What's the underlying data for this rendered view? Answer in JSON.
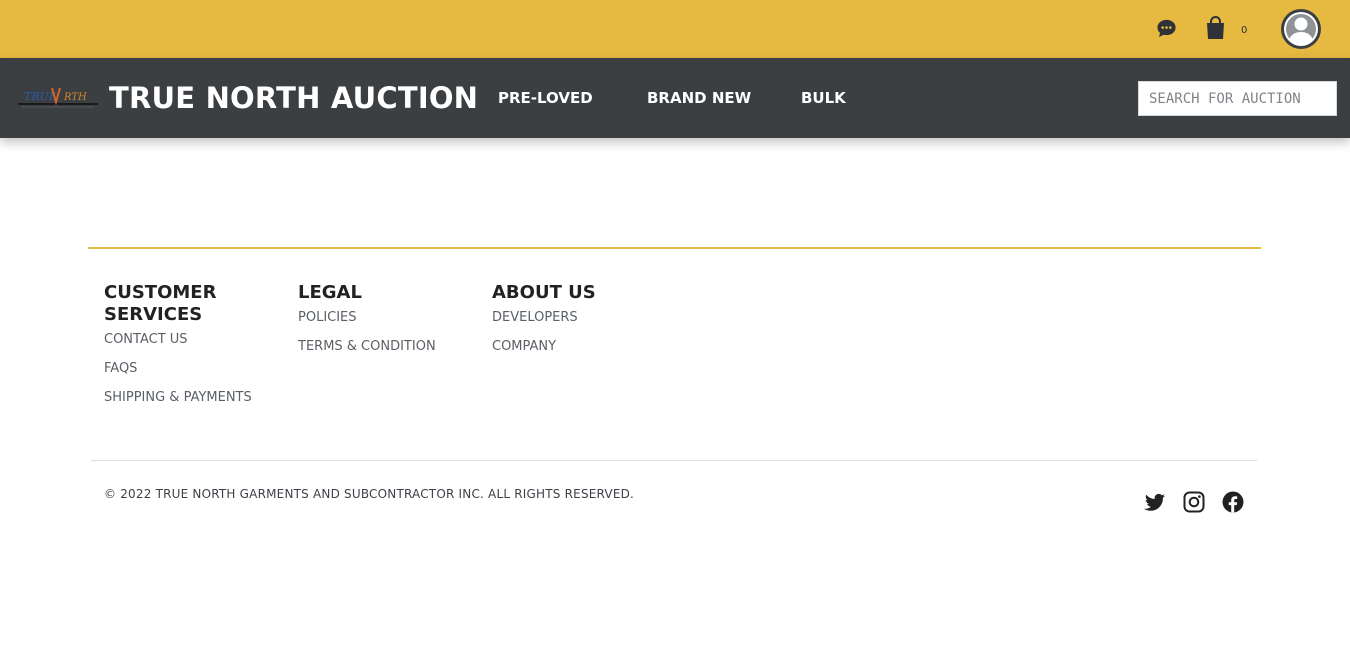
{
  "topbar": {
    "background": "#e6b940",
    "chat_icon": "chat-bubble-icon",
    "cart_icon": "shopping-bag-icon",
    "cart_count": "0",
    "avatar_icon": "user-avatar-icon"
  },
  "navbar": {
    "background": "#3b3f42",
    "logo_icon": "true-north-logo",
    "brand": "TRUE NORTH AUCTION",
    "links": [
      "PRE-LOVED",
      "BRAND NEW",
      "BULK"
    ],
    "search_placeholder": "SEARCH FOR AUCTION"
  },
  "footer": {
    "accent": "#e6b940",
    "columns": [
      {
        "title": "CUSTOMER SERVICES",
        "links": [
          "CONTACT US",
          "FAQS",
          "SHIPPING & PAYMENTS"
        ]
      },
      {
        "title": "LEGAL",
        "links": [
          "POLICIES",
          "TERMS & CONDITION"
        ]
      },
      {
        "title": "ABOUT US",
        "links": [
          "DEVELOPERS",
          "COMPANY"
        ]
      }
    ],
    "copyright": "© 2022 TRUE NORTH GARMENTS AND SUBCONTRACTOR INC. ALL RIGHTS RESERVED.",
    "social_icons": [
      "twitter-icon",
      "instagram-icon",
      "facebook-icon"
    ]
  }
}
